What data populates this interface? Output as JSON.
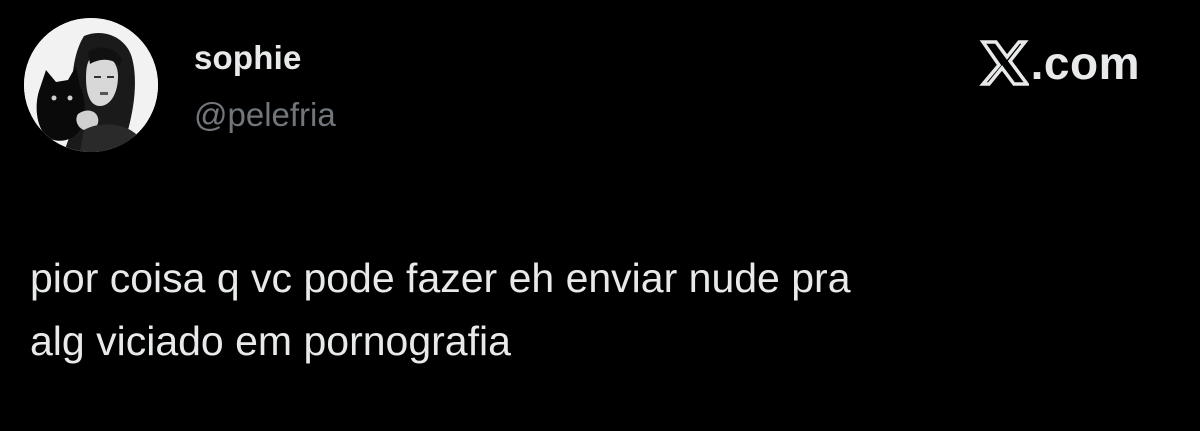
{
  "author": {
    "display_name": "sophie",
    "handle": "@pelefria",
    "avatar_icon": "profile-photo-woman-with-black-cat"
  },
  "brand": {
    "icon": "x-logo-icon",
    "text": ".com"
  },
  "tweet": {
    "lines": [
      "pior coisa q vc pode fazer eh enviar nude pra",
      "alg viciado em pornografia"
    ]
  },
  "colors": {
    "background": "#000000",
    "primary_text": "#e7e9ea",
    "secondary_text": "#71767b"
  }
}
